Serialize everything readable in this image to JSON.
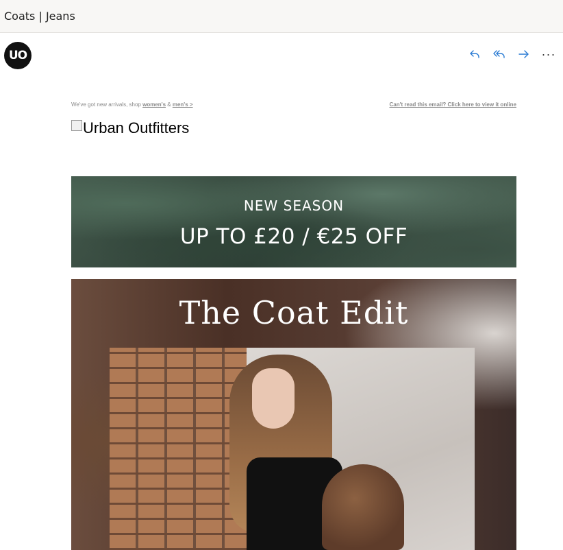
{
  "email": {
    "subject": "Coats | Jeans",
    "sender_avatar": "UO",
    "actions": [
      {
        "name": "reply",
        "icon": "reply-icon"
      },
      {
        "name": "reply-all",
        "icon": "reply-all-icon"
      },
      {
        "name": "forward",
        "icon": "forward-icon"
      },
      {
        "name": "more",
        "icon": "more-icon",
        "label": "···"
      }
    ],
    "accent_color": "#2b7cd3"
  },
  "preheader": {
    "text": "We've got new arrivals, shop",
    "womens_link": "women's",
    "amp": "&",
    "mens_link": "men's >",
    "view_online": "Can't read this email? Click here to view it online"
  },
  "logo": {
    "alt": "Urban Outfitters"
  },
  "banner": {
    "line1": "NEW SEASON",
    "line2": "UP TO £20 / €25 OFF"
  },
  "hero": {
    "title": "The Coat Edit"
  }
}
